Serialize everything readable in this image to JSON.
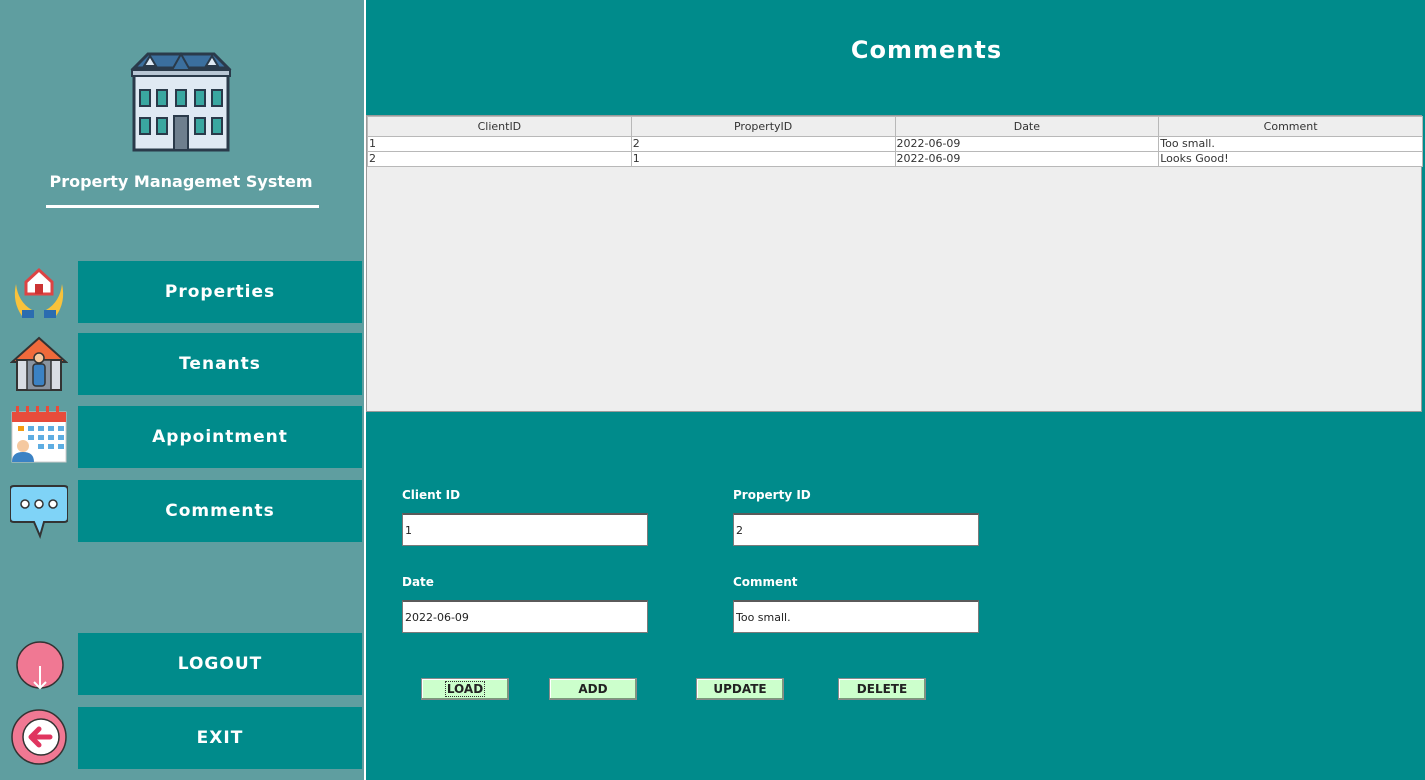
{
  "app": {
    "title": "Property Managemet System"
  },
  "nav": {
    "properties": "Properties",
    "tenants": "Tenants",
    "appointment": "Appointment",
    "comments": "Comments",
    "logout": "LOGOUT",
    "exit": "EXIT"
  },
  "icons": {
    "logo": "building-icon",
    "properties": "hands-house-icon",
    "tenants": "house-person-icon",
    "appointment": "calendar-person-icon",
    "comments": "chat-bubble-icon",
    "logout": "logout-icon",
    "exit": "exit-arrow-icon"
  },
  "page": {
    "title": "Comments"
  },
  "table": {
    "columns": [
      "ClientID",
      "PropertyID",
      "Date",
      "Comment"
    ],
    "rows": [
      [
        "1",
        "2",
        "2022-06-09",
        "Too small."
      ],
      [
        "2",
        "1",
        "2022-06-09",
        "Looks Good!"
      ]
    ]
  },
  "form": {
    "client_id_label": "Client ID",
    "client_id_value": "1",
    "property_id_label": "Property ID",
    "property_id_value": "2",
    "date_label": "Date",
    "date_value": "2022-06-09",
    "comment_label": "Comment",
    "comment_value": "Too small."
  },
  "actions": {
    "load": "LOAD",
    "add": "ADD",
    "update": "UPDATE",
    "delete": "DELETE"
  },
  "colors": {
    "sidebar": "#5f9ea0",
    "main": "#008b8b",
    "button": "#ccffcc",
    "table_bg": "#eeeeee"
  }
}
